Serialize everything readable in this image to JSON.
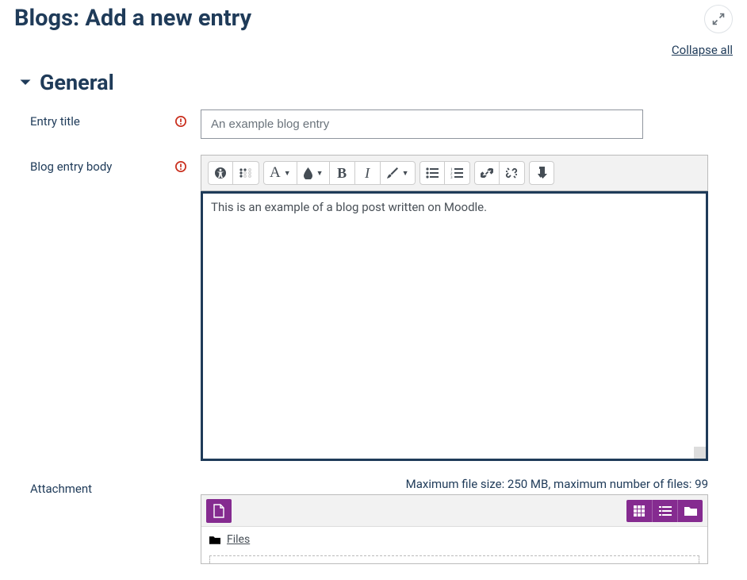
{
  "header": {
    "title": "Blogs: Add a new entry",
    "collapse_all": "Collapse all"
  },
  "section": {
    "general_title": "General"
  },
  "labels": {
    "entry_title": "Entry title",
    "blog_entry_body": "Blog entry body",
    "attachment": "Attachment"
  },
  "fields": {
    "entry_title_value": "An example blog entry",
    "body_value": "This is an example of a blog post written on Moodle."
  },
  "attachment": {
    "limits_text": "Maximum file size: 250 MB, maximum number of files: 99",
    "files_label": "Files"
  },
  "toolbar": {
    "font_label": "A",
    "bold_label": "B",
    "italic_label": "I"
  }
}
